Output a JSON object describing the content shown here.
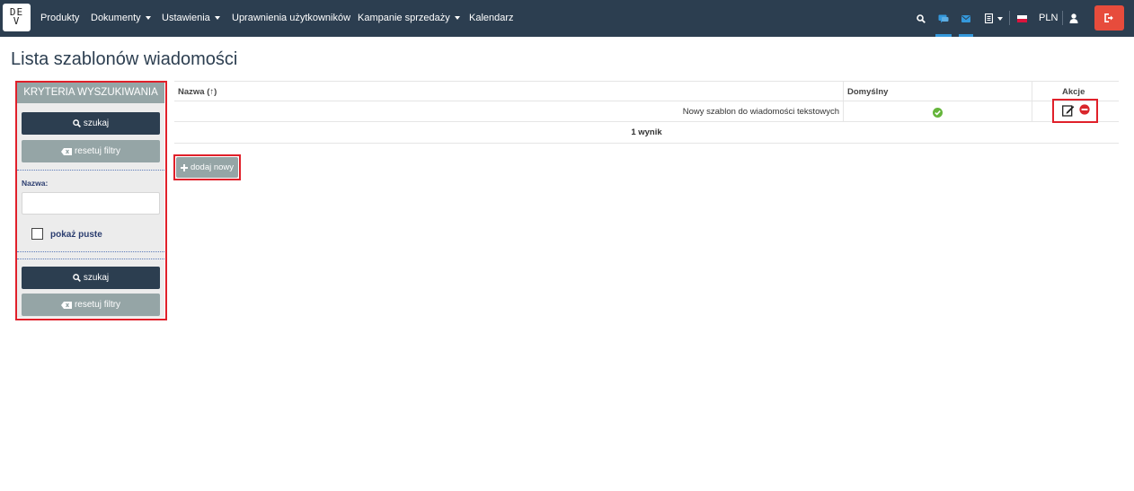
{
  "nav": {
    "logo_line1": "DE",
    "logo_line2": "V",
    "items": [
      {
        "label": "Produkty",
        "dropdown": false
      },
      {
        "label": "Dokumenty",
        "dropdown": true
      },
      {
        "label": "Ustawienia",
        "dropdown": true
      },
      {
        "label": "Uprawnienia użytkowników",
        "dropdown": false
      },
      {
        "label": "Kampanie sprzedaży",
        "dropdown": true
      },
      {
        "label": "Kalendarz",
        "dropdown": false
      }
    ],
    "currency": "PLN",
    "icons": [
      "search-icon",
      "chat-icon",
      "mail-icon",
      "document-icon",
      "flag-pl-icon",
      "user-icon",
      "logout-icon"
    ]
  },
  "page": {
    "title": "Lista szablonów wiadomości"
  },
  "sidebar": {
    "header": "KRYTERIA WYSZUKIWANIA",
    "search_label": "szukaj",
    "reset_label": "resetuj filtry",
    "name_label": "Nazwa:",
    "name_value": "",
    "show_empty_label": "pokaż puste",
    "show_empty_checked": false
  },
  "table": {
    "columns": [
      "Nazwa (↑)",
      "Domyślny",
      "Akcje"
    ],
    "rows": [
      {
        "name": "Nowy szablon do wiadomości tekstowych",
        "default": true
      }
    ],
    "summary": "1 wynik"
  },
  "add_button": "dodaj nowy",
  "colors": {
    "navbar": "#2c3e50",
    "accent_blue": "#3498db",
    "danger": "#e74c3c",
    "grey_button": "#95a5a6",
    "success": "#65b53b",
    "highlight": "#e0202a"
  }
}
